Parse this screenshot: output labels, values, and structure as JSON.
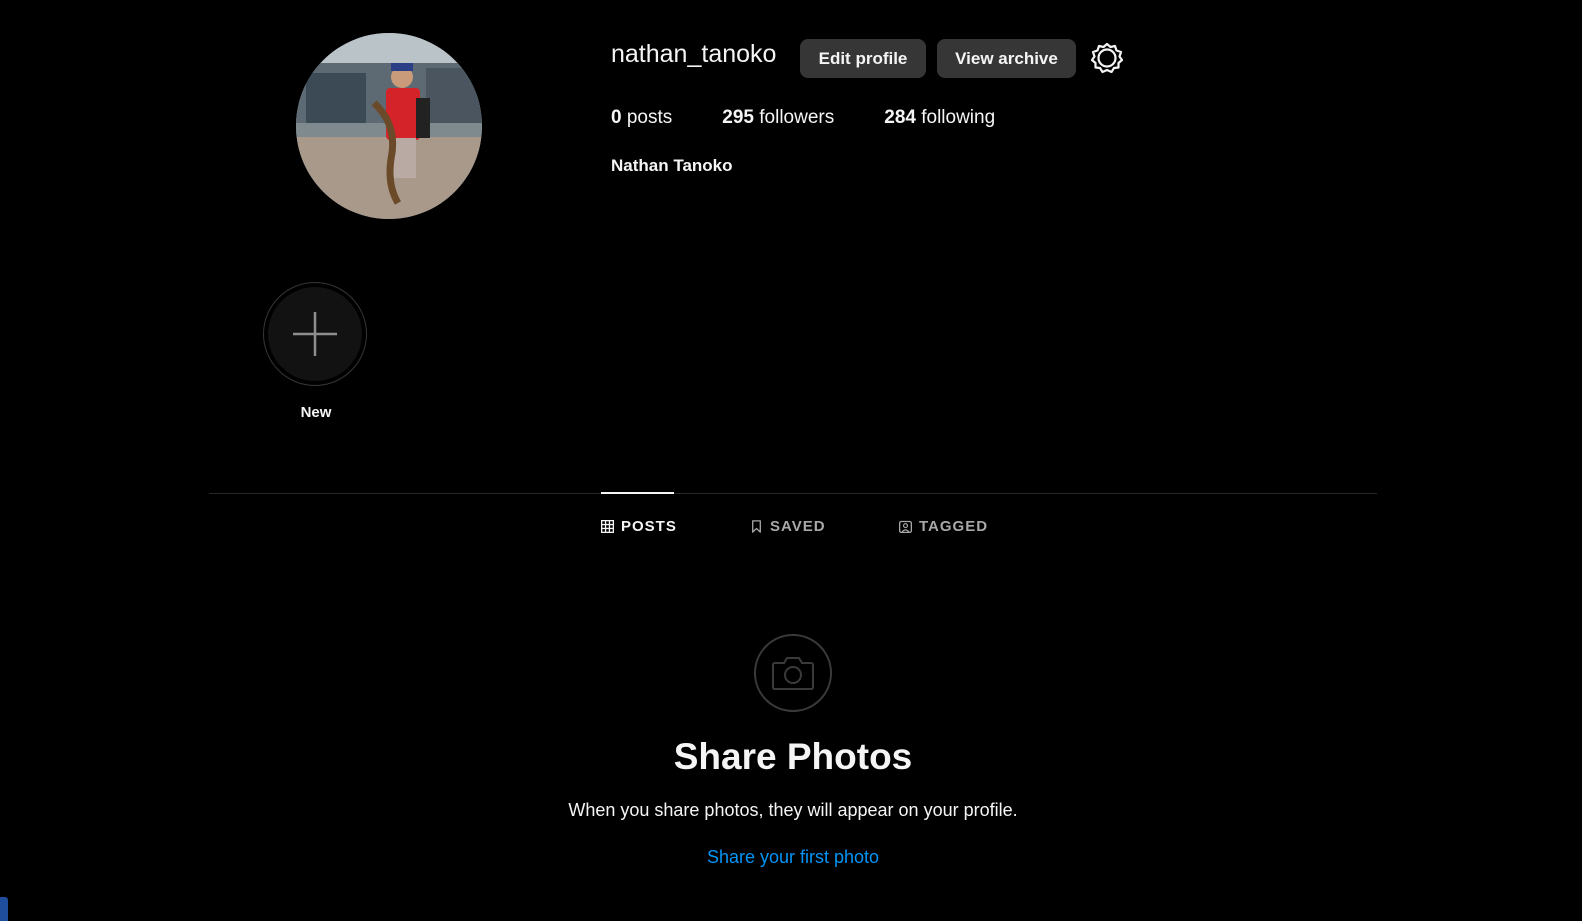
{
  "profile": {
    "username": "nathan_tanoko",
    "full_name": "Nathan Tanoko",
    "edit_profile_label": "Edit profile",
    "view_archive_label": "View archive",
    "stats": {
      "posts_count": "0",
      "posts_label": "posts",
      "followers_count": "295",
      "followers_label": "followers",
      "following_count": "284",
      "following_label": "following"
    }
  },
  "highlights": {
    "new_label": "New"
  },
  "tabs": [
    {
      "label": "POSTS",
      "icon": "grid-icon",
      "active": true
    },
    {
      "label": "SAVED",
      "icon": "bookmark-icon",
      "active": false
    },
    {
      "label": "TAGGED",
      "icon": "tagged-icon",
      "active": false
    }
  ],
  "empty_state": {
    "icon": "camera-icon",
    "title": "Share Photos",
    "subtitle": "When you share photos, they will appear on your profile.",
    "link": "Share your first photo"
  },
  "colors": {
    "background": "#000000",
    "button_bg": "#363636",
    "link": "#0095f6",
    "muted": "#a8a8a8"
  }
}
